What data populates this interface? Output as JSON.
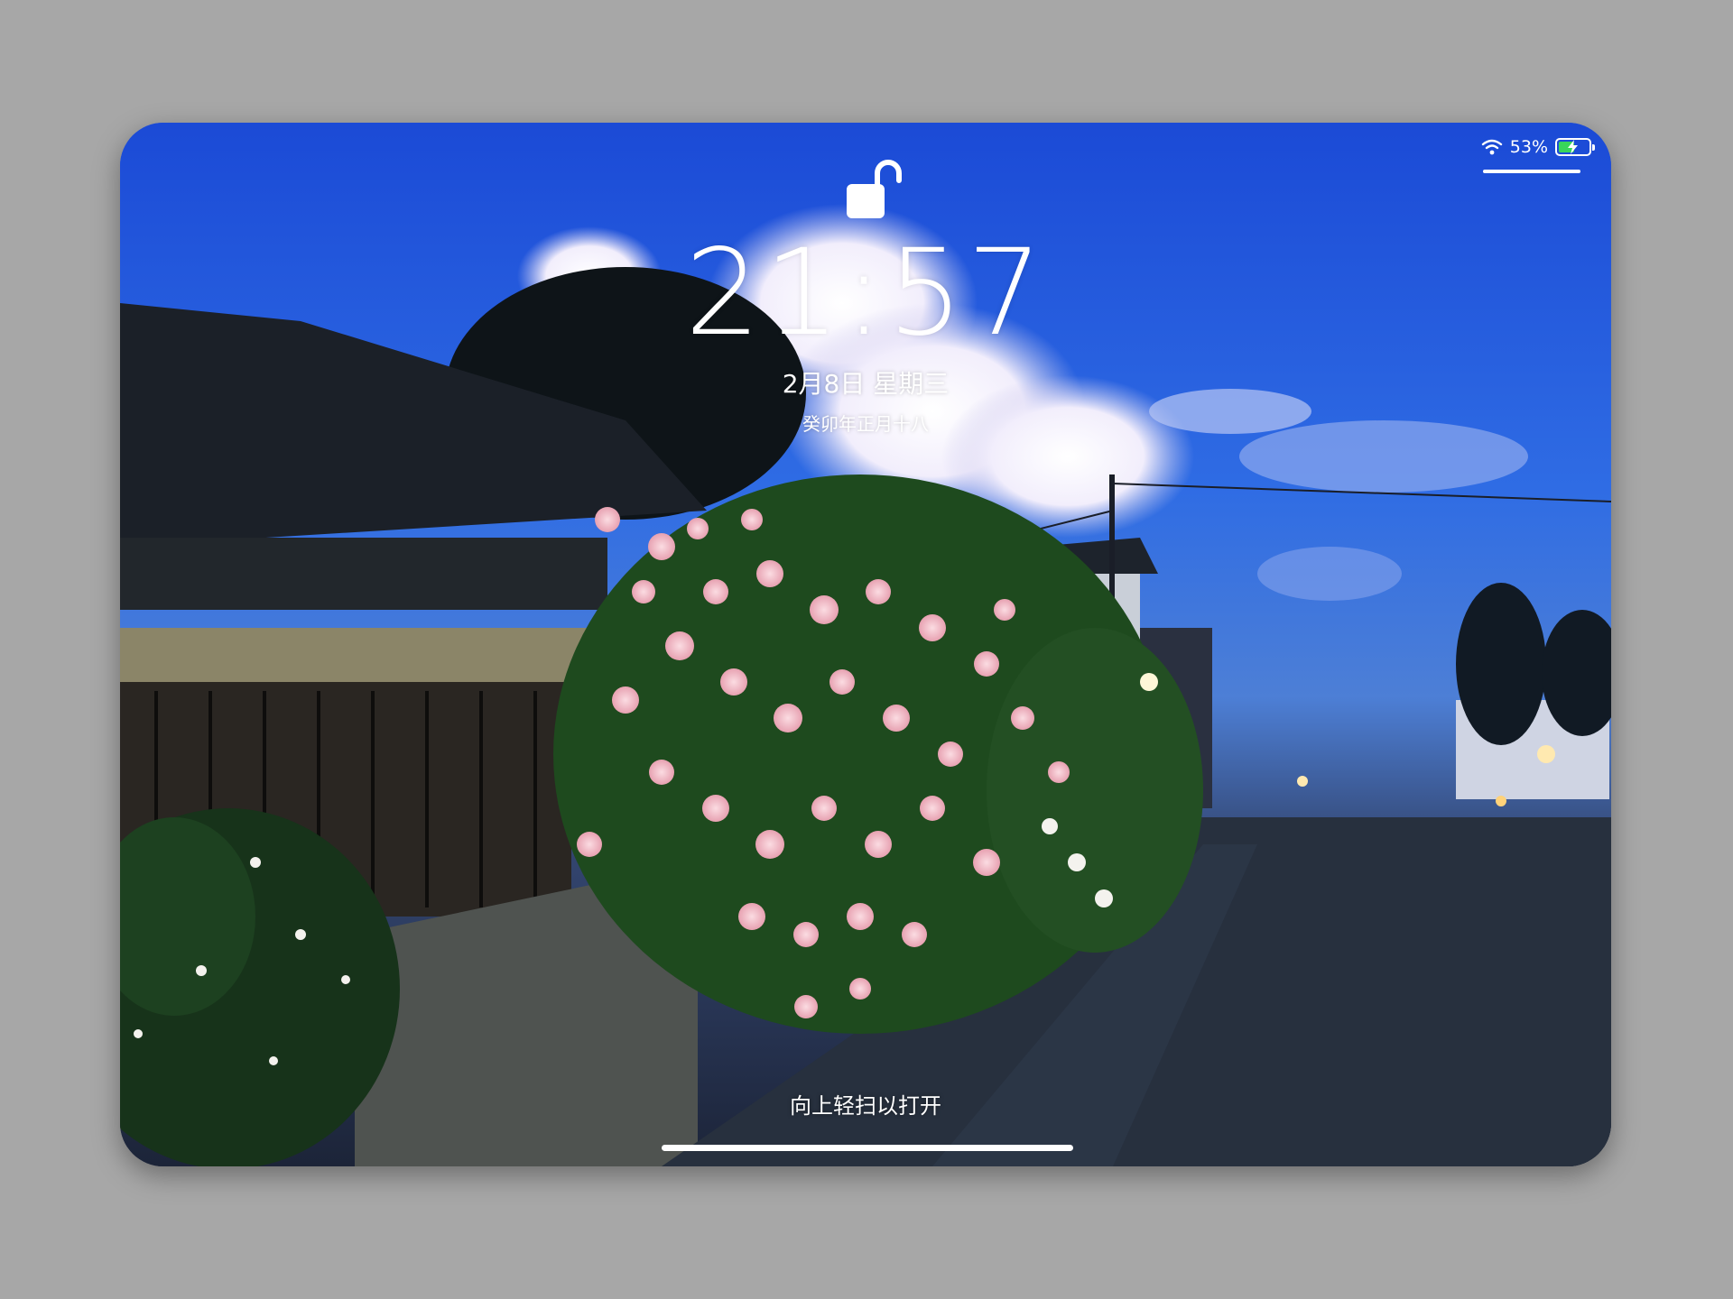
{
  "status_bar": {
    "battery_text": "53%",
    "battery_level": 0.53,
    "wifi_icon": "wifi-icon",
    "battery_icon": "battery-charging-icon",
    "battery_color": "#39d65a"
  },
  "lock": {
    "icon": "unlocked-padlock-icon"
  },
  "clock": {
    "time": "21:57",
    "date": "2月8日 星期三",
    "lunar": "癸卯年正月十八"
  },
  "hint": {
    "swipe_text": "向上轻扫以打开"
  }
}
